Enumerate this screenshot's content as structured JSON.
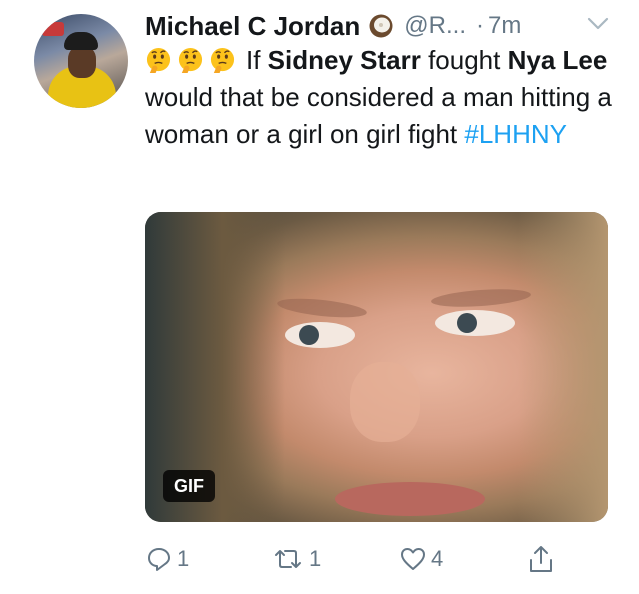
{
  "tweet": {
    "author_name": "Michael C Jordan",
    "author_emoji": "coconut",
    "handle": "@R...",
    "separator": "·",
    "time": "7m",
    "text": {
      "emojis": [
        "thinking-face",
        "thinking-face",
        "thinking-face"
      ],
      "part1": "If ",
      "mention1": "Sidney Starr",
      "part2": " fought ",
      "mention2": "Nya Lee",
      "part3": " would that be considered a man hitting a woman or a girl on girl fight ",
      "hashtag": "#LHHNY"
    },
    "media": {
      "badge": "GIF"
    },
    "actions": {
      "replies": "1",
      "retweets": "1",
      "likes": "4"
    }
  },
  "colors": {
    "text": "#14171a",
    "secondary": "#657786",
    "link": "#1da1f2"
  }
}
